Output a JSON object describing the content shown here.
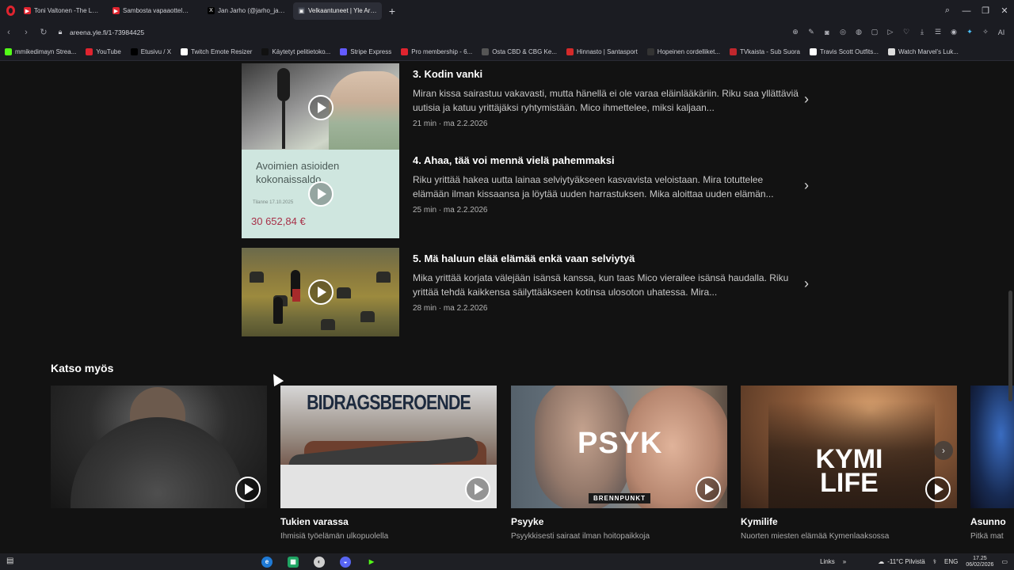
{
  "browser": {
    "tabs": [
      {
        "label": "Toni Valtonen -The Last D",
        "color": "#e0242f",
        "icon": "youtube-icon"
      },
      {
        "label": "Sambosta vapaaotteluun",
        "color": "#e0242f",
        "icon": "youtube-icon"
      },
      {
        "label": "Jan Jarho (@jarho_jan) / X",
        "color": "#000000",
        "icon": "x-icon"
      },
      {
        "label": "Velkaantuneet | Yle Areena",
        "color": "#3b3f4a",
        "icon": "yle-icon"
      }
    ],
    "url": "areena.yle.fi/1-73984425",
    "bookmarks": [
      {
        "label": "mmikedimayn Strea...",
        "color": "#53fc18",
        "icon": "kick-icon"
      },
      {
        "label": "YouTube",
        "color": "#e0242f",
        "icon": "youtube-icon"
      },
      {
        "label": "Etusivu / X",
        "color": "#000000",
        "icon": "x-icon"
      },
      {
        "label": "Twitch Emote Resizer",
        "color": "#ffffff",
        "icon": "page-icon"
      },
      {
        "label": "Käytetyt pelitietoko...",
        "color": "#111111",
        "icon": "n-icon"
      },
      {
        "label": "Stripe Express",
        "color": "#635bff",
        "icon": "stripe-icon"
      },
      {
        "label": "Pro membership - 6...",
        "color": "#e0242f",
        "icon": "pin-icon"
      },
      {
        "label": "Osta CBD & CBG Ke...",
        "color": "#555555",
        "icon": "globe-icon"
      },
      {
        "label": "Hinnasto | Santasport",
        "color": "#d42a2a",
        "icon": "s-icon"
      },
      {
        "label": "Hopeinen cordelliket...",
        "color": "#333333",
        "icon": "kt-icon"
      },
      {
        "label": "TVkaista - Sub Suora",
        "color": "#c0272d",
        "icon": "tv-icon"
      },
      {
        "label": "Travis Scott Outfits...",
        "color": "#ffffff",
        "icon": "w-icon"
      },
      {
        "label": "Watch Marvel's Luk...",
        "color": "#dddddd",
        "icon": "openai-icon"
      }
    ]
  },
  "episodes": [
    {
      "title": "3. Kodin vanki",
      "desc": "Miran kissa sairastuu vakavasti, mutta hänellä ei ole varaa eläinlääkäriin. Riku saa yllättäviä uutisia ja katuu yrittäjäksi ryhtymistään. Mico ihmettelee, miksi kaljaan...",
      "meta": "21 min  ·  ma 2.2.2026"
    },
    {
      "title": "4. Ahaa, tää voi mennä vielä pahemmaksi",
      "desc": "Riku yrittää hakea uutta lainaa selviytyäkseen kasvavista veloistaan. Mira totuttelee elämään ilman kissaansa ja löytää uuden harrastuksen. Mika aloittaa uuden elämän...",
      "meta": "25 min  ·  ma 2.2.2026",
      "thumb_text": {
        "heading": "Avoimien asioiden kokonaissaldo",
        "date": "Tilanne 17.10.2025",
        "amount": "30 652,84 €"
      }
    },
    {
      "title": "5. Mä haluun elää elämää enkä vaan selviytyä",
      "desc": "Mika yrittää korjata välejään isänsä kanssa, kun taas Mico vierailee isänsä haudalla. Riku yrittää tehdä kaikkensa säilyttääkseen kotinsa ulosoton uhatessa. Mira...",
      "meta": "28 min  ·  ma 2.2.2026"
    }
  ],
  "see_also": {
    "title": "Katso myös",
    "cards": [
      {
        "title": "",
        "subtitle": ""
      },
      {
        "title": "Tukien varassa",
        "subtitle": "Ihmisiä työelämän ulkopuolella",
        "art": "BIDRAGSBEROENDE"
      },
      {
        "title": "Psyyke",
        "subtitle": "Psyykkisesti sairaat ilman hoitopaikkoja",
        "art": "PSYK",
        "tag": "BRENNPUNKT"
      },
      {
        "title": "Kymilife",
        "subtitle": "Nuorten miesten elämää Kymenlaaksossa",
        "art": "KYMI LIFE"
      },
      {
        "title": "Asunno",
        "subtitle": "Pitkä mat"
      }
    ]
  },
  "taskbar": {
    "links": "Links",
    "weather": "-11°C  Pilvistä",
    "lang": "ENG",
    "time": "17.25",
    "date": "06/02/2026"
  }
}
